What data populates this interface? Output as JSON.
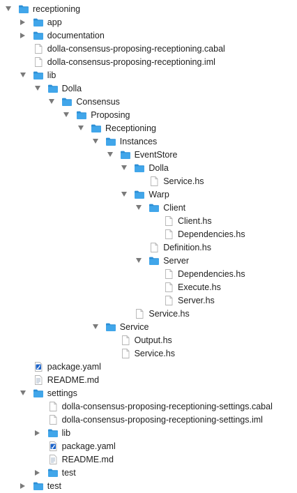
{
  "colors": {
    "folder": "#41a6ea",
    "folder_tab": "#2c8fd6",
    "triangle": "#7a7a7a",
    "text": "#1e1e1e"
  },
  "tree": [
    {
      "label": "receptioning",
      "kind": "folder",
      "depth": 0,
      "toggle": "open"
    },
    {
      "label": "app",
      "kind": "folder",
      "depth": 1,
      "toggle": "closed"
    },
    {
      "label": "documentation",
      "kind": "folder",
      "depth": 1,
      "toggle": "closed"
    },
    {
      "label": "dolla-consensus-proposing-receptioning.cabal",
      "kind": "file",
      "depth": 1,
      "toggle": "none"
    },
    {
      "label": "dolla-consensus-proposing-receptioning.iml",
      "kind": "file",
      "depth": 1,
      "toggle": "none"
    },
    {
      "label": "lib",
      "kind": "folder",
      "depth": 1,
      "toggle": "open"
    },
    {
      "label": "Dolla",
      "kind": "folder",
      "depth": 2,
      "toggle": "open"
    },
    {
      "label": "Consensus",
      "kind": "folder",
      "depth": 3,
      "toggle": "open"
    },
    {
      "label": "Proposing",
      "kind": "folder",
      "depth": 4,
      "toggle": "open"
    },
    {
      "label": "Receptioning",
      "kind": "folder",
      "depth": 5,
      "toggle": "open"
    },
    {
      "label": "Instances",
      "kind": "folder",
      "depth": 6,
      "toggle": "open"
    },
    {
      "label": "EventStore",
      "kind": "folder",
      "depth": 7,
      "toggle": "open"
    },
    {
      "label": "Dolla",
      "kind": "folder",
      "depth": 8,
      "toggle": "open"
    },
    {
      "label": "Service.hs",
      "kind": "file",
      "depth": 9,
      "toggle": "none"
    },
    {
      "label": "Warp",
      "kind": "folder",
      "depth": 8,
      "toggle": "open"
    },
    {
      "label": "Client",
      "kind": "folder",
      "depth": 9,
      "toggle": "open"
    },
    {
      "label": "Client.hs",
      "kind": "file",
      "depth": 10,
      "toggle": "none"
    },
    {
      "label": "Dependencies.hs",
      "kind": "file",
      "depth": 10,
      "toggle": "none"
    },
    {
      "label": "Definition.hs",
      "kind": "file",
      "depth": 9,
      "toggle": "none"
    },
    {
      "label": "Server",
      "kind": "folder",
      "depth": 9,
      "toggle": "open"
    },
    {
      "label": "Dependencies.hs",
      "kind": "file",
      "depth": 10,
      "toggle": "none"
    },
    {
      "label": "Execute.hs",
      "kind": "file",
      "depth": 10,
      "toggle": "none"
    },
    {
      "label": "Server.hs",
      "kind": "file",
      "depth": 10,
      "toggle": "none"
    },
    {
      "label": "Service.hs",
      "kind": "file",
      "depth": 8,
      "toggle": "none"
    },
    {
      "label": "Service",
      "kind": "folder",
      "depth": 6,
      "toggle": "open"
    },
    {
      "label": "Output.hs",
      "kind": "file",
      "depth": 7,
      "toggle": "none"
    },
    {
      "label": "Service.hs",
      "kind": "file",
      "depth": 7,
      "toggle": "none"
    },
    {
      "label": "package.yaml",
      "kind": "yaml",
      "depth": 1,
      "toggle": "none"
    },
    {
      "label": "README.md",
      "kind": "doc",
      "depth": 1,
      "toggle": "none"
    },
    {
      "label": "settings",
      "kind": "folder",
      "depth": 1,
      "toggle": "open"
    },
    {
      "label": "dolla-consensus-proposing-receptioning-settings.cabal",
      "kind": "file",
      "depth": 2,
      "toggle": "none"
    },
    {
      "label": "dolla-consensus-proposing-receptioning-settings.iml",
      "kind": "file",
      "depth": 2,
      "toggle": "none"
    },
    {
      "label": "lib",
      "kind": "folder",
      "depth": 2,
      "toggle": "closed"
    },
    {
      "label": "package.yaml",
      "kind": "yaml",
      "depth": 2,
      "toggle": "none"
    },
    {
      "label": "README.md",
      "kind": "doc",
      "depth": 2,
      "toggle": "none"
    },
    {
      "label": "test",
      "kind": "folder",
      "depth": 2,
      "toggle": "closed"
    },
    {
      "label": "test",
      "kind": "folder",
      "depth": 1,
      "toggle": "closed"
    }
  ]
}
